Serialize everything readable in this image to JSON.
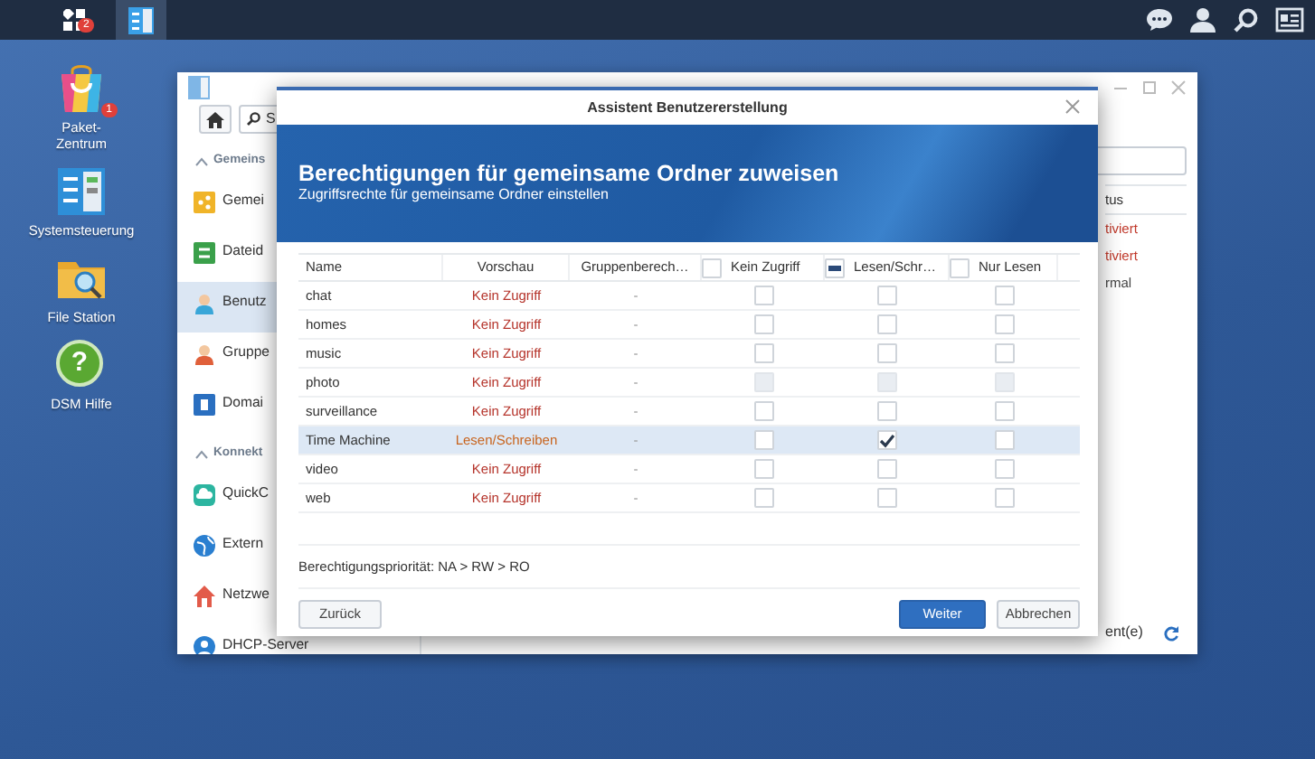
{
  "taskbar": {
    "menu_badge": "2",
    "apps": [
      {
        "selected": true
      }
    ]
  },
  "desktop_icons": [
    {
      "label": "Paket-\nZentrum",
      "badge": "1",
      "kind": "package"
    },
    {
      "label": "Systemsteuerung",
      "kind": "control"
    },
    {
      "label": "File Station",
      "kind": "files"
    },
    {
      "label": "DSM Hilfe",
      "kind": "help",
      "glyph": "?"
    }
  ],
  "window": {
    "search": {
      "value": "S"
    },
    "sidebar": [
      {
        "kind": "section",
        "label": "Gemeins"
      },
      {
        "kind": "item",
        "label": "Gemei",
        "selected": false
      },
      {
        "kind": "item",
        "label": "Dateid",
        "selected": false
      },
      {
        "kind": "item",
        "label": "Benutz",
        "selected": true
      },
      {
        "kind": "item",
        "label": "Gruppe",
        "selected": false
      },
      {
        "kind": "item",
        "label": "Domai",
        "selected": false
      },
      {
        "kind": "section",
        "label": "Konnekt"
      },
      {
        "kind": "item",
        "label": "QuickC",
        "selected": false
      },
      {
        "kind": "item",
        "label": "Extern",
        "selected": false
      },
      {
        "kind": "item",
        "label": "Netzwe",
        "selected": false
      },
      {
        "kind": "item",
        "label": "DHCP-Server",
        "selected": false
      }
    ],
    "status_header": "tus",
    "status_cells": [
      {
        "text": "tiviert",
        "color": "#c0392b"
      },
      {
        "text": "tiviert",
        "color": "#c0392b"
      },
      {
        "text": "rmal",
        "color": "#444444"
      }
    ],
    "footer_text": "ent(e)"
  },
  "dialog": {
    "title": "Assistent Benutzererstellung",
    "heading": "Berechtigungen für gemeinsame Ordner zuweisen",
    "subtitle": "Zugriffsrechte für gemeinsame Ordner einstellen",
    "columns": [
      {
        "label": "Name",
        "kind": "text"
      },
      {
        "label": "Vorschau",
        "kind": "text"
      },
      {
        "label": "Gruppenberech…",
        "kind": "text"
      },
      {
        "label": "Kein Zugriff",
        "kind": "checkbox",
        "mixed": false
      },
      {
        "label": "Lesen/Schr…",
        "kind": "checkbox",
        "mixed": true
      },
      {
        "label": "Nur Lesen",
        "kind": "checkbox",
        "mixed": false
      }
    ],
    "rows": [
      {
        "name": "chat",
        "preview": "Kein Zugriff",
        "color": "#b5332a",
        "group": "-",
        "selected": false,
        "permissions": [
          {
            "checked": false,
            "disabled": false
          },
          {
            "checked": false,
            "disabled": false
          },
          {
            "checked": false,
            "disabled": false
          }
        ]
      },
      {
        "name": "homes",
        "preview": "Kein Zugriff",
        "color": "#b5332a",
        "group": "-",
        "selected": false,
        "permissions": [
          {
            "checked": false,
            "disabled": false
          },
          {
            "checked": false,
            "disabled": false
          },
          {
            "checked": false,
            "disabled": false
          }
        ]
      },
      {
        "name": "music",
        "preview": "Kein Zugriff",
        "color": "#b5332a",
        "group": "-",
        "selected": false,
        "permissions": [
          {
            "checked": false,
            "disabled": false
          },
          {
            "checked": false,
            "disabled": false
          },
          {
            "checked": false,
            "disabled": false
          }
        ]
      },
      {
        "name": "photo",
        "preview": "Kein Zugriff",
        "color": "#b5332a",
        "group": "-",
        "selected": false,
        "permissions": [
          {
            "checked": false,
            "disabled": true
          },
          {
            "checked": false,
            "disabled": true
          },
          {
            "checked": false,
            "disabled": true
          }
        ]
      },
      {
        "name": "surveillance",
        "preview": "Kein Zugriff",
        "color": "#b5332a",
        "group": "-",
        "selected": false,
        "permissions": [
          {
            "checked": false,
            "disabled": false
          },
          {
            "checked": false,
            "disabled": false
          },
          {
            "checked": false,
            "disabled": false
          }
        ]
      },
      {
        "name": "Time Machine",
        "preview": "Lesen/Schreiben",
        "color": "#c8641e",
        "group": "-",
        "selected": true,
        "permissions": [
          {
            "checked": false,
            "disabled": false
          },
          {
            "checked": true,
            "disabled": false
          },
          {
            "checked": false,
            "disabled": false
          }
        ]
      },
      {
        "name": "video",
        "preview": "Kein Zugriff",
        "color": "#b5332a",
        "group": "-",
        "selected": false,
        "permissions": [
          {
            "checked": false,
            "disabled": false
          },
          {
            "checked": false,
            "disabled": false
          },
          {
            "checked": false,
            "disabled": false
          }
        ]
      },
      {
        "name": "web",
        "preview": "Kein Zugriff",
        "color": "#b5332a",
        "group": "-",
        "selected": false,
        "permissions": [
          {
            "checked": false,
            "disabled": false
          },
          {
            "checked": false,
            "disabled": false
          },
          {
            "checked": false,
            "disabled": false
          }
        ]
      }
    ],
    "note": "Berechtigungspriorität: NA > RW > RO",
    "buttons": [
      {
        "label": "Zurück",
        "kind": "plain"
      },
      {
        "label": "Weiter",
        "kind": "primary"
      },
      {
        "label": "Abbrechen",
        "kind": "plain"
      }
    ]
  }
}
